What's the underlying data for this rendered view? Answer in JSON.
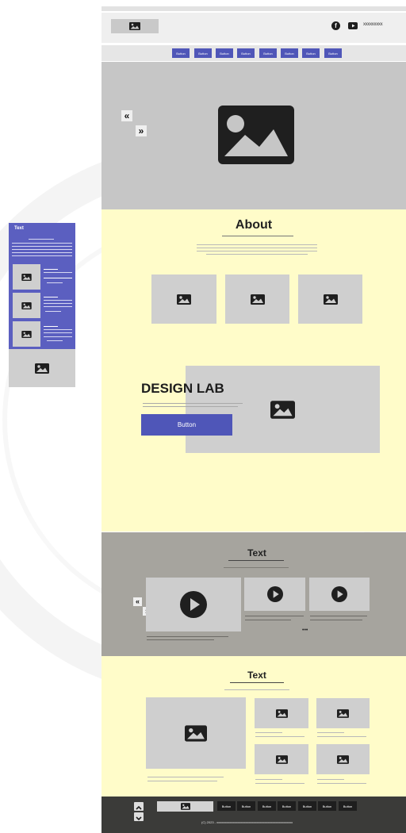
{
  "header": {
    "account_text": "xxxxxxxxx",
    "icons": [
      "image-icon",
      "facebook-icon",
      "youtube-icon"
    ]
  },
  "nav": {
    "items": [
      "Button",
      "Button",
      "Button",
      "Button",
      "Button",
      "Button",
      "Button",
      "Button"
    ]
  },
  "hero": {
    "prev_label": "«",
    "next_label": "»"
  },
  "about": {
    "title": "About"
  },
  "design_lab": {
    "title": "DESIGN LAB",
    "button_label": "Button"
  },
  "video_section": {
    "title": "Text",
    "prev_label": "«",
    "next_label": "»",
    "dots": "•••"
  },
  "news_section": {
    "title": "Text"
  },
  "sidebar_mobile": {
    "title": "Text"
  },
  "footer": {
    "items": [
      "Button",
      "Button",
      "Button",
      "Button",
      "Button",
      "Button",
      "Button"
    ],
    "copyright": "(C) 2023 - xxxxxxxxxxxxxxxxxxxxxxxxxxxxxxxxxxxxxxxxxxxxxxxx"
  },
  "colors": {
    "accent": "#4f56b8",
    "hero_bg": "#c6c6c6",
    "about_bg": "#fffcc9",
    "video_bg": "#a6a49e",
    "news_bg": "#fffcc9",
    "footer_bg": "#3b3b39"
  }
}
